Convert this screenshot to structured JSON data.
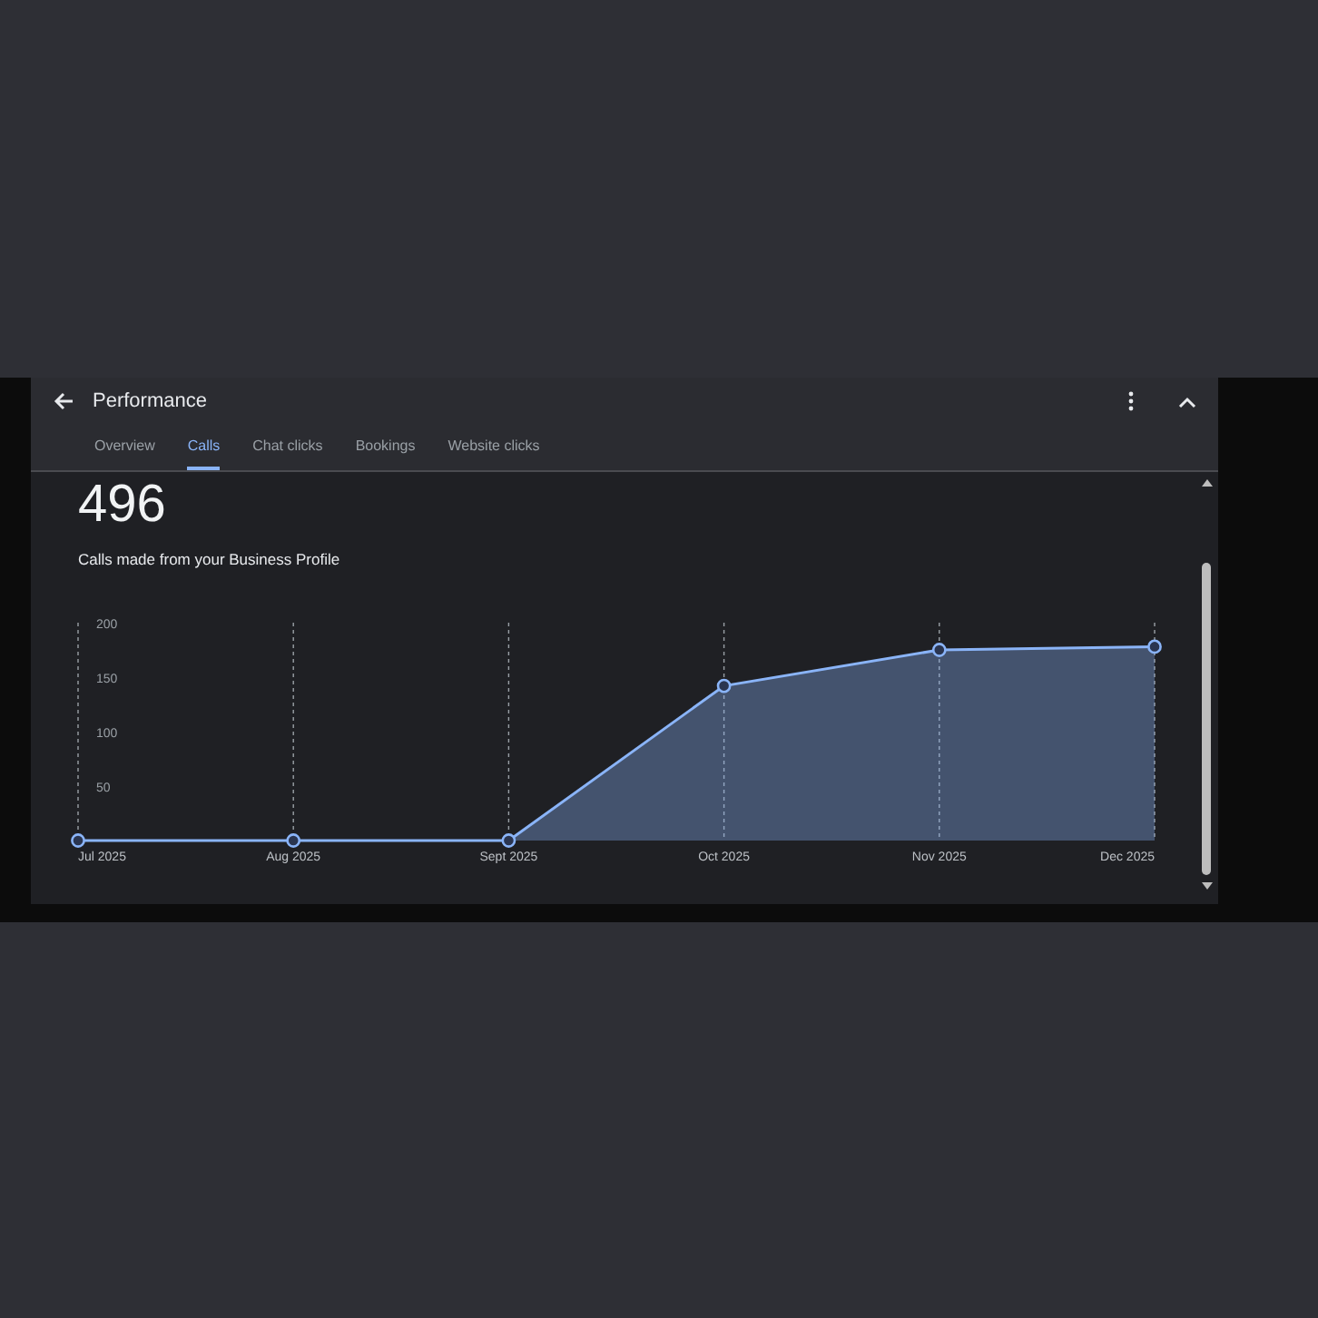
{
  "header": {
    "title": "Performance"
  },
  "tabs": [
    {
      "label": "Overview",
      "selected": false
    },
    {
      "label": "Calls",
      "selected": true
    },
    {
      "label": "Chat clicks",
      "selected": false
    },
    {
      "label": "Bookings",
      "selected": false
    },
    {
      "label": "Website clicks",
      "selected": false
    }
  ],
  "metric": {
    "value": "496",
    "caption": "Calls made from your Business Profile"
  },
  "chart_data": {
    "type": "area",
    "categories": [
      "Jul 2025",
      "Aug 2025",
      "Sept 2025",
      "Oct 2025",
      "Nov 2025",
      "Dec 2025"
    ],
    "series": [
      {
        "color": "#8ab4f8",
        "values": [
          0,
          0,
          0,
          142,
          175,
          178
        ]
      }
    ],
    "grid": true,
    "ylim": [
      0,
      200
    ],
    "yticks": [
      50,
      100,
      150,
      200
    ]
  }
}
